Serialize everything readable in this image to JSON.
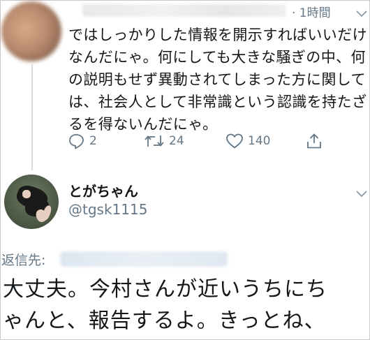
{
  "tweet1": {
    "time": "· 1時間",
    "lines": [
      "ではしっかりした情報を開示すればいいだけ",
      "なんだにゃ。何にしても大きな騒ぎの中、何",
      "の説明もせず異動されてしまった方に関して",
      "は、社会人として非常識という認識を持たざ",
      "るを得ないんだにゃ。"
    ],
    "actions": {
      "replies": "2",
      "retweets": "24",
      "likes": "140"
    }
  },
  "tweet2": {
    "display_name": "とがちゃん",
    "handle": "@tgsk1115",
    "reply_to_label": "返信先:",
    "lines": [
      "大丈夫。今村さんが近いうちにち",
      "ゃんと、報告するよ。きっとね、"
    ]
  },
  "icons": {
    "reply": "reply-icon",
    "retweet": "retweet-icon",
    "like": "heart-icon",
    "share": "share-icon",
    "caret": "chevron-down-icon"
  },
  "colors": {
    "secondary_text": "#657786",
    "primary_text": "#14171a",
    "thread_line": "#d5dbe0"
  }
}
